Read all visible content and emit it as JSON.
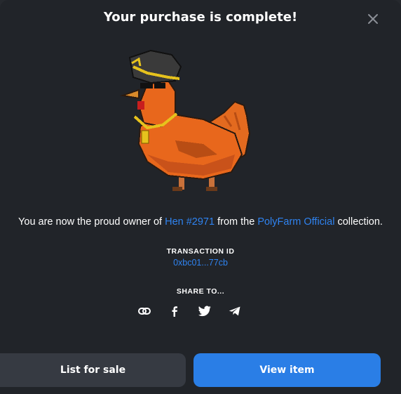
{
  "modal": {
    "title": "Your purchase is complete!"
  },
  "owner": {
    "prefix": "You are now the proud owner of ",
    "item_name": "Hen #2971",
    "middle": " from the ",
    "collection_name": "PolyFarm Official",
    "suffix": " collection."
  },
  "transaction": {
    "label": "TRANSACTION ID",
    "id": "0xbc01...77cb"
  },
  "share": {
    "label": "SHARE TO...",
    "icons": [
      "link-icon",
      "facebook-icon",
      "twitter-icon",
      "telegram-icon"
    ]
  },
  "actions": {
    "list_label": "List for sale",
    "view_label": "View item"
  },
  "colors": {
    "background": "#212429",
    "link": "#2f83f0",
    "primary_button": "#2a7ee6",
    "secondary_button": "#363a42"
  }
}
